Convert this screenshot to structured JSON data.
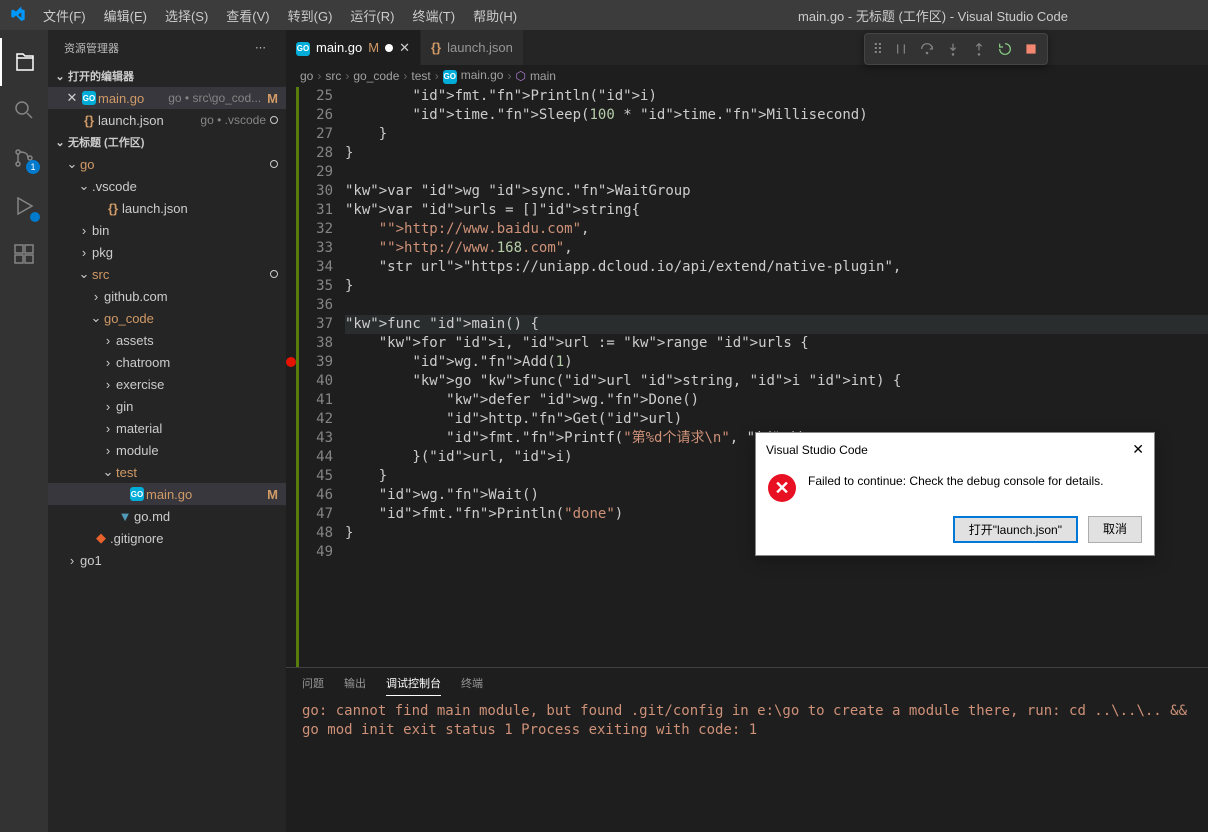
{
  "title": "main.go - 无标题 (工作区) - Visual Studio Code",
  "menu": [
    "文件(F)",
    "编辑(E)",
    "选择(S)",
    "查看(V)",
    "转到(G)",
    "运行(R)",
    "终端(T)",
    "帮助(H)"
  ],
  "sidebar": {
    "title": "资源管理器",
    "openEditors": "打开的编辑器",
    "editors": [
      {
        "name": "main.go",
        "desc": "go • src\\go_cod...",
        "mod": "M",
        "active": true
      },
      {
        "name": "launch.json",
        "desc": "go • .vscode"
      }
    ],
    "workspace": "无标题 (工作区)",
    "tree": [
      {
        "d": 1,
        "t": "folder",
        "o": true,
        "n": "go",
        "dot": true,
        "mod": true
      },
      {
        "d": 2,
        "t": "folder",
        "o": true,
        "n": ".vscode"
      },
      {
        "d": 3,
        "t": "file",
        "i": "json",
        "n": "launch.json"
      },
      {
        "d": 2,
        "t": "folder",
        "o": false,
        "n": "bin"
      },
      {
        "d": 2,
        "t": "folder",
        "o": false,
        "n": "pkg"
      },
      {
        "d": 2,
        "t": "folder",
        "o": true,
        "n": "src",
        "dot": true,
        "mod": true
      },
      {
        "d": 3,
        "t": "folder",
        "o": false,
        "n": "github.com"
      },
      {
        "d": 3,
        "t": "folder",
        "o": true,
        "n": "go_code",
        "mod": true
      },
      {
        "d": 4,
        "t": "folder",
        "o": false,
        "n": "assets"
      },
      {
        "d": 4,
        "t": "folder",
        "o": false,
        "n": "chatroom"
      },
      {
        "d": 4,
        "t": "folder",
        "o": false,
        "n": "exercise"
      },
      {
        "d": 4,
        "t": "folder",
        "o": false,
        "n": "gin"
      },
      {
        "d": 4,
        "t": "folder",
        "o": false,
        "n": "material"
      },
      {
        "d": 4,
        "t": "folder",
        "o": false,
        "n": "module"
      },
      {
        "d": 4,
        "t": "folder",
        "o": true,
        "n": "test",
        "mod": true
      },
      {
        "d": 5,
        "t": "file",
        "i": "go",
        "n": "main.go",
        "sel": true,
        "mtag": "M",
        "mod": true
      },
      {
        "d": 4,
        "t": "file",
        "i": "md",
        "n": "go.md"
      },
      {
        "d": 2,
        "t": "file",
        "i": "git",
        "n": ".gitignore"
      },
      {
        "d": 1,
        "t": "folder",
        "o": false,
        "n": "go1"
      }
    ]
  },
  "tabs": [
    {
      "name": "main.go",
      "i": "go",
      "active": true,
      "mod": "M",
      "dirty": true
    },
    {
      "name": "launch.json",
      "i": "json"
    }
  ],
  "crumbs": [
    "go",
    "src",
    "go_code",
    "test",
    "main.go",
    "main"
  ],
  "code": {
    "start": 25,
    "bp": 39,
    "hl": 37,
    "lines": [
      "        fmt.Println(i)",
      "        time.Sleep(100 * time.Millisecond)",
      "    }",
      "}",
      "",
      "var wg sync.WaitGroup",
      "var urls = []string{",
      "    \"http://www.baidu.com\",",
      "    \"http://www.168.com\",",
      "    \"https://uniapp.dcloud.io/api/extend/native-plugin\",",
      "}",
      "",
      "func main() {",
      "    for i, url := range urls {",
      "        wg.Add(1)",
      "        go func(url string, i int) {",
      "            defer wg.Done()",
      "            http.Get(url)",
      "            fmt.Printf(\"第%d个请求\\n\", i)",
      "        }(url, i)",
      "    }",
      "    wg.Wait()",
      "    fmt.Println(\"done\")",
      "}",
      ""
    ]
  },
  "activity": {
    "scmBadge": "1"
  },
  "panel": {
    "tabs": [
      "问题",
      "输出",
      "调试控制台",
      "终端"
    ],
    "active": 2,
    "output": "go: cannot find main module, but found .git/config in e:\\go\n        to create a module there, run:\n        cd ..\\..\\.. && go mod init\nexit status 1\nProcess exiting with code: 1"
  },
  "dialog": {
    "title": "Visual Studio Code",
    "msg": "Failed to continue: Check the debug console for details.",
    "primary": "打开\"launch.json\"",
    "cancel": "取消"
  }
}
